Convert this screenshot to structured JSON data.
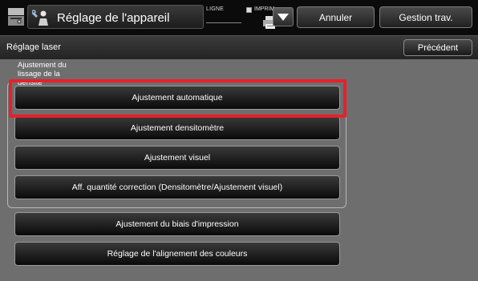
{
  "header": {
    "title": "Réglage de l'appareil",
    "ligne_label": "LIGNE",
    "imprim_label": "IMPRIM.",
    "cancel_label": "Annuler",
    "job_management_label": "Gestion trav."
  },
  "subheader": {
    "title": "Réglage laser",
    "back_label": "Précédent"
  },
  "group": {
    "label_lines": [
      "Ajustement du",
      "lissage de la",
      "densité"
    ],
    "options": [
      {
        "label": "Ajustement automatique",
        "highlighted": true
      },
      {
        "label": "Ajustement densitomètre"
      },
      {
        "label": "Ajustement visuel"
      },
      {
        "label": "Aff. quantité correction (Densitomètre/Ajustement visuel)"
      }
    ]
  },
  "other_options": [
    {
      "label": "Ajustement du biais d'impression"
    },
    {
      "label": "Réglage de l'alignement des couleurs"
    }
  ],
  "colors": {
    "highlight": "#e8202a",
    "content_background": "#6e6e6e",
    "button_dark": "#0a0a0a"
  },
  "icons": {
    "app": "machine-settings-icon",
    "title": "wrench-person-icon",
    "printer": "printer-icon",
    "dropdown": "triangle-down-icon"
  }
}
